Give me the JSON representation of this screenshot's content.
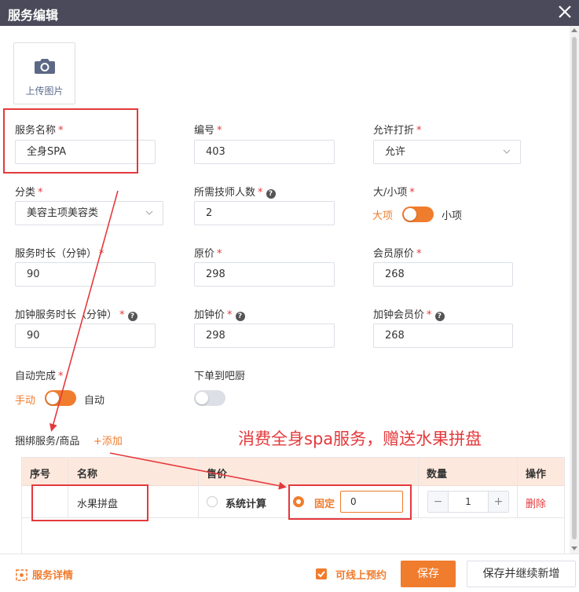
{
  "dialog": {
    "title": "服务编辑"
  },
  "upload": {
    "label": "上传图片"
  },
  "fields": {
    "name": {
      "label": "服务名称",
      "value": "全身SPA"
    },
    "code": {
      "label": "编号",
      "value": "403"
    },
    "discount": {
      "label": "允许打折",
      "value": "允许"
    },
    "category": {
      "label": "分类",
      "value": "美容主项美容类"
    },
    "technicians": {
      "label": "所需技师人数",
      "value": "2"
    },
    "size": {
      "label": "大/小项",
      "on_label": "大项",
      "off_label": "小项",
      "is_on": true
    },
    "duration": {
      "label": "服务时长（分钟）",
      "value": "90"
    },
    "price": {
      "label": "原价",
      "value": "298"
    },
    "member_price": {
      "label": "会员原价",
      "value": "268"
    },
    "extra_duration": {
      "label": "加钟服务时长（分钟）",
      "value": "90"
    },
    "extra_price": {
      "label": "加钟价",
      "value": "298"
    },
    "extra_member_price": {
      "label": "加钟会员价",
      "value": "268"
    },
    "auto_complete": {
      "label": "自动完成",
      "on_label": "手动",
      "off_label": "自动",
      "is_on": true
    },
    "bar_kitchen": {
      "label": "下单到吧厨",
      "is_on": false
    }
  },
  "bundle": {
    "label": "捆绑服务/商品",
    "add_label": "+添加",
    "columns": [
      "序号",
      "名称",
      "售价",
      "数量",
      "操作"
    ],
    "rows": [
      {
        "index": "",
        "name": "水果拼盘",
        "price_option_system": "系统计算",
        "price_option_fixed": "固定",
        "fixed_value": "0",
        "quantity": "1",
        "action": "删除"
      }
    ]
  },
  "annotation": "消费全身spa服务，赠送水果拼盘",
  "footer": {
    "details_label": "服务详情",
    "online_booking_label": "可线上预约",
    "online_booking_checked": true,
    "save_label": "保存",
    "save_continue_label": "保存并继续新增"
  },
  "colors": {
    "accent": "#f07c2d",
    "titlebar": "#4a4a5a",
    "annotation_red": "#e4393c"
  }
}
